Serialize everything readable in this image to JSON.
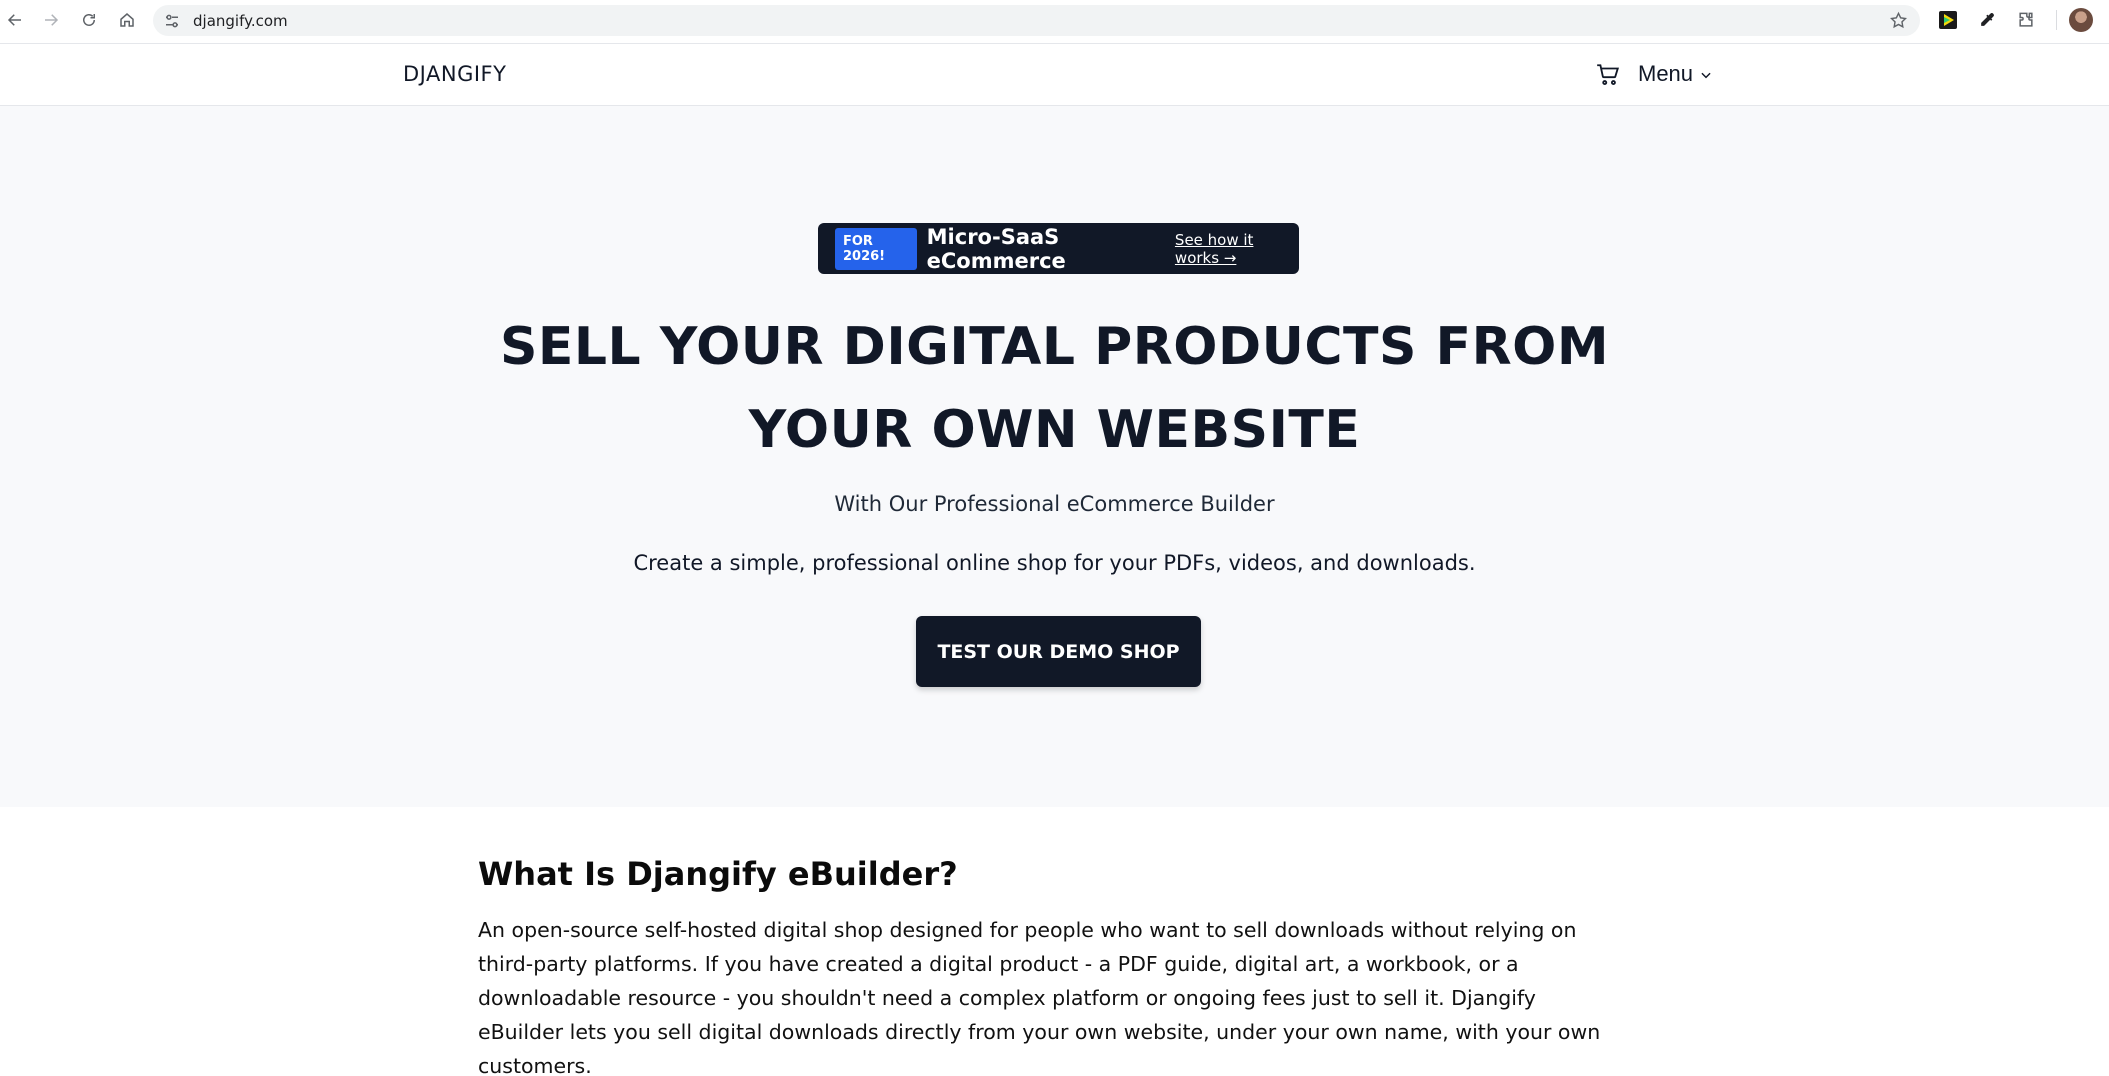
{
  "browser": {
    "url": "djangify.com",
    "icons": {
      "back": "arrow-left-icon",
      "forward": "arrow-right-icon",
      "reload": "reload-icon",
      "home": "home-icon",
      "site_settings": "tune-icon",
      "bookmark": "star-icon",
      "ext1": "media-extension-icon",
      "ext2": "eyedropper-icon",
      "ext3": "puzzle-icon",
      "profile": "avatar"
    }
  },
  "header": {
    "brand": "DJANGIFY",
    "menu_label": "Menu",
    "cart_icon": "cart-icon"
  },
  "hero": {
    "badge": "FOR 2026!",
    "pill_title": "Micro-SaaS eCommerce",
    "pill_link": "See how it works →",
    "headline_line1": "SELL YOUR DIGITAL PRODUCTS FROM",
    "headline_line2": "YOUR OWN WEBSITE",
    "subhead": "With Our Professional eCommerce Builder",
    "lede": "Create a simple, professional online shop for your PDFs, videos, and downloads.",
    "cta": "TEST OUR DEMO SHOP"
  },
  "about": {
    "title": "What Is Djangify eBuilder?",
    "body": "An open-source self-hosted digital shop designed for people who want to sell downloads without relying on third-party platforms. If you have created a digital product - a PDF guide, digital art, a workbook, or a downloadable resource - you shouldn't need a complex platform or ongoing fees just to sell it. Djangify eBuilder lets you sell digital downloads directly from your own website, under your own name, with your own customers."
  },
  "colors": {
    "primary_dark": "#111827",
    "badge_blue": "#2563eb",
    "hero_bg": "#f8f9fb"
  }
}
